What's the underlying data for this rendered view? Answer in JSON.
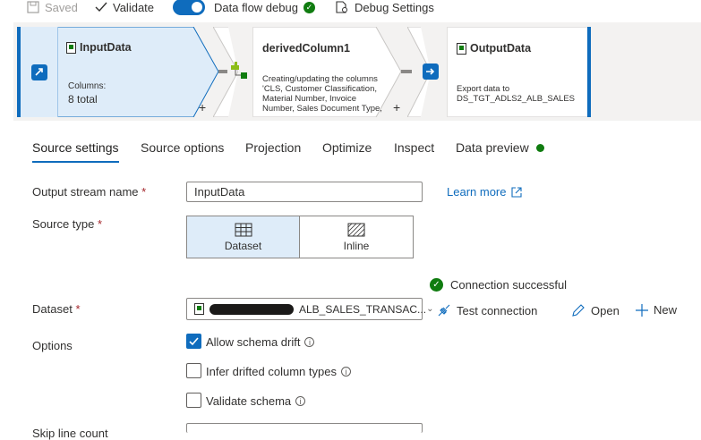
{
  "toolbar": {
    "saved_label": "Saved",
    "validate_label": "Validate",
    "debug_toggle_label": "Data flow debug",
    "debug_settings_label": "Debug Settings"
  },
  "canvas": {
    "nodes": [
      {
        "title": "InputData",
        "sub_label": "Columns:",
        "sub_value": "8 total"
      },
      {
        "title": "derivedColumn1",
        "description": "Creating/updating the columns 'CLS, Customer Classification, Material Number, Invoice Number, Sales Document Type, ..."
      },
      {
        "title": "OutputData",
        "description": "Export data to DS_TGT_ADLS2_ALB_SALES"
      }
    ],
    "plus_symbol": "+"
  },
  "tabs": [
    {
      "label": "Source settings",
      "active": true
    },
    {
      "label": "Source options"
    },
    {
      "label": "Projection"
    },
    {
      "label": "Optimize"
    },
    {
      "label": "Inspect"
    },
    {
      "label": "Data preview",
      "status_color": "#107c10"
    }
  ],
  "form": {
    "output_stream": {
      "label": "Output stream name",
      "required_mark": "*",
      "value": "InputData",
      "learn_more": "Learn more"
    },
    "source_type": {
      "label": "Source type",
      "required_mark": "*",
      "options": [
        {
          "label": "Dataset",
          "selected": true
        },
        {
          "label": "Inline"
        }
      ]
    },
    "connection_status": "Connection successful",
    "dataset": {
      "label": "Dataset",
      "required_mark": "*",
      "value": "ALB_SALES_TRANSAC...",
      "test_connection": "Test connection",
      "open": "Open",
      "new": "New"
    },
    "options": {
      "label": "Options",
      "allow_schema_drift": {
        "label": "Allow schema drift",
        "checked": true
      },
      "infer_drifted": {
        "label": "Infer drifted column types",
        "checked": false
      },
      "validate_schema": {
        "label": "Validate schema",
        "checked": false
      }
    },
    "skip_line_count": {
      "label": "Skip line count"
    }
  },
  "colors": {
    "accent": "#0f6cbd",
    "success": "#107c10",
    "required": "#a4262c"
  }
}
